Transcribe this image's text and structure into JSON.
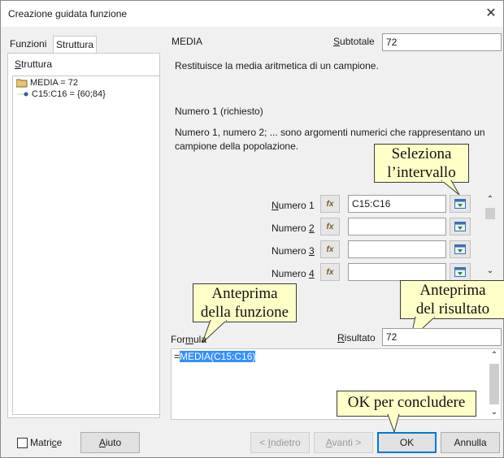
{
  "window": {
    "title": "Creazione guidata funzione"
  },
  "tabs": [
    {
      "label": "Funzioni"
    },
    {
      "label": "Struttura"
    }
  ],
  "structure": {
    "heading": "Struttura",
    "root": "MEDIA = 72",
    "child": "C15:C16 = {60;84}"
  },
  "function": {
    "name": "MEDIA",
    "subtotal_label": "Subtotale",
    "subtotal_value": "72",
    "description": "Restituisce la media aritmetica di un campione.",
    "arg_title": "Numero 1 (richiesto)",
    "arg_description": "Numero 1, numero 2; ... sono argomenti numerici che rappresentano un campione della popolazione."
  },
  "args": [
    {
      "label": "Numero 1",
      "value": "C15:C16"
    },
    {
      "label": "Numero 2",
      "value": ""
    },
    {
      "label": "Numero 3",
      "value": ""
    },
    {
      "label": "Numero 4",
      "value": ""
    }
  ],
  "formula": {
    "label": "Formula",
    "prefix": "=",
    "selected_text": "MEDIA(C15:C16)",
    "result_label": "Risultato",
    "result_value": "72"
  },
  "callouts": {
    "select_range": [
      "Seleziona",
      "l’intervallo"
    ],
    "function_preview": [
      "Anteprima",
      "della funzione"
    ],
    "result_preview": [
      "Anteprima",
      "del risultato"
    ],
    "ok": "OK per concludere"
  },
  "buttons": {
    "matrix": "Matrice",
    "help": "Aiuto",
    "back": "< Indietro",
    "next": "Avanti >",
    "ok": "OK",
    "cancel": "Annulla"
  },
  "colors": {
    "accent": "#0078d7",
    "selection": "#3390ff",
    "callout_bg": "#ffffc8"
  }
}
